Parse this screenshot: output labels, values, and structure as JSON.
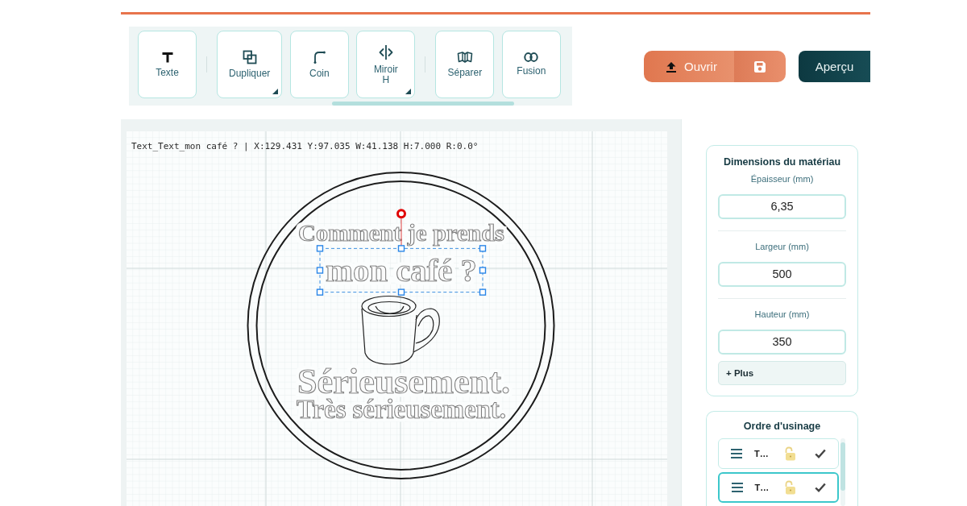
{
  "toolbar": {
    "groups": [
      {
        "tools": [
          {
            "label": "Texte",
            "has_menu": false
          }
        ]
      },
      {
        "tools": [
          {
            "label": "Dupliquer",
            "has_menu": true
          },
          {
            "label": "Coin",
            "has_menu": false
          },
          {
            "label": "Miroir\nH",
            "has_menu": true
          }
        ]
      },
      {
        "tools": [
          {
            "label": "Séparer",
            "has_menu": false
          },
          {
            "label": "Fusion",
            "has_menu": false
          }
        ]
      }
    ]
  },
  "actions": [
    {
      "kind": "open",
      "label": "Ouvrir"
    },
    {
      "kind": "save"
    },
    {
      "kind": "preview",
      "label": "Aperçu"
    }
  ],
  "canvas": {
    "status": "Text_Text_mon café ? | X:129.431 Y:97.035 W:41.138 H:7.000 R:0.0°",
    "texts": [
      {
        "text": "Comment je prends",
        "selected": false
      },
      {
        "text": "mon café ?",
        "selected": true
      },
      {
        "text": "Sérieusement.",
        "selected": false
      },
      {
        "text": "Très sérieusement.",
        "selected": false
      }
    ]
  },
  "material": {
    "title": "Dimensions du matériau",
    "fields": [
      {
        "label": "Épaisseur (mm)",
        "value": "6,35"
      },
      {
        "label": "Largeur (mm)",
        "value": "500"
      },
      {
        "label": "Hauteur (mm)",
        "value": "350"
      }
    ],
    "more_button": "+ Plus"
  },
  "machining_order": {
    "title": "Ordre d'usinage",
    "items": [
      {
        "label": "T…",
        "locked": false,
        "enabled": true,
        "selected": false
      },
      {
        "label": "T…",
        "locked": false,
        "enabled": true,
        "selected": true
      }
    ]
  }
}
